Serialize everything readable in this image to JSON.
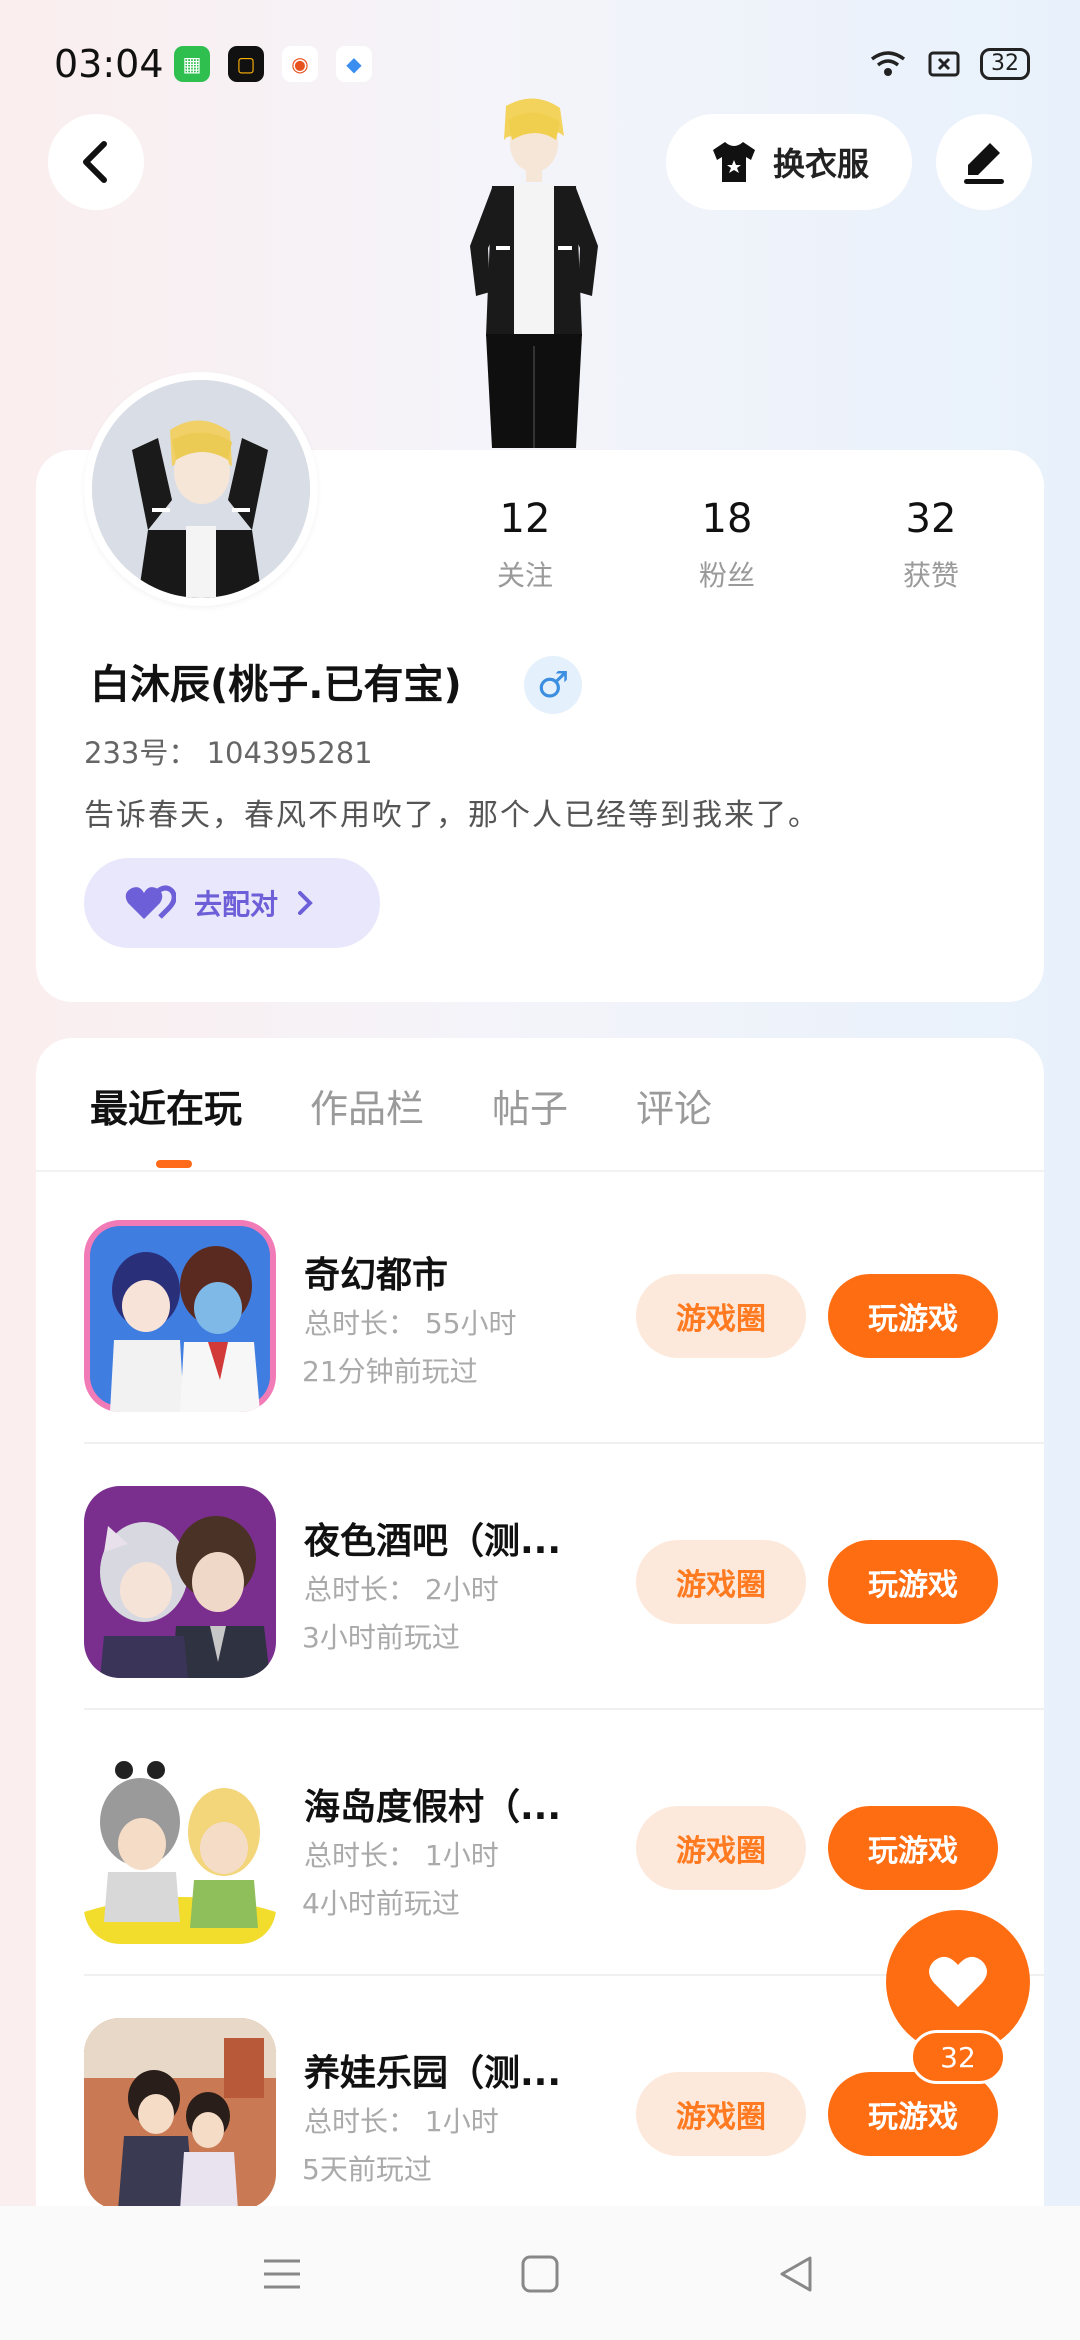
{
  "status_bar": {
    "time": "03:04",
    "battery": "32",
    "icons": [
      "app-green-icon",
      "app-black-icon",
      "app-orange-icon",
      "app-blue-icon",
      "wifi-icon",
      "sim-icon",
      "battery-icon"
    ]
  },
  "header": {
    "dress_label": "换衣服"
  },
  "profile": {
    "stats": [
      {
        "value": "12",
        "label": "关注"
      },
      {
        "value": "18",
        "label": "粉丝"
      },
      {
        "value": "32",
        "label": "获赞"
      }
    ],
    "name": "白沐辰(桃子.已有宝)",
    "gender_symbol": "♂",
    "id_text": "233号： 104395281",
    "bio": "告诉春天，春风不用吹了，那个人已经等到我来了。",
    "match_label": "去配对"
  },
  "tabs": [
    {
      "label": "最近在玩"
    },
    {
      "label": "作品栏"
    },
    {
      "label": "帖子"
    },
    {
      "label": "评论"
    }
  ],
  "games": [
    {
      "name": "奇幻都市",
      "total": "总时长： 55小时",
      "last": "21分钟前玩过",
      "circle_label": "游戏圈",
      "play_label": "玩游戏"
    },
    {
      "name": "夜色酒吧（测...",
      "total": "总时长： 2小时",
      "last": "3小时前玩过",
      "circle_label": "游戏圈",
      "play_label": "玩游戏"
    },
    {
      "name": "海岛度假村（...",
      "total": "总时长： 1小时",
      "last": "4小时前玩过",
      "circle_label": "游戏圈",
      "play_label": "玩游戏"
    },
    {
      "name": "养娃乐园（测...",
      "total": "总时长： 1小时",
      "last": "5天前玩过",
      "circle_label": "游戏圈",
      "play_label": "玩游戏"
    }
  ],
  "like_fab": {
    "count": "32"
  },
  "colors": {
    "accent": "#ff6d12",
    "accent_light": "#fde9dc",
    "match_bg": "#e9e7fb",
    "match_text": "#6d5fd8"
  }
}
